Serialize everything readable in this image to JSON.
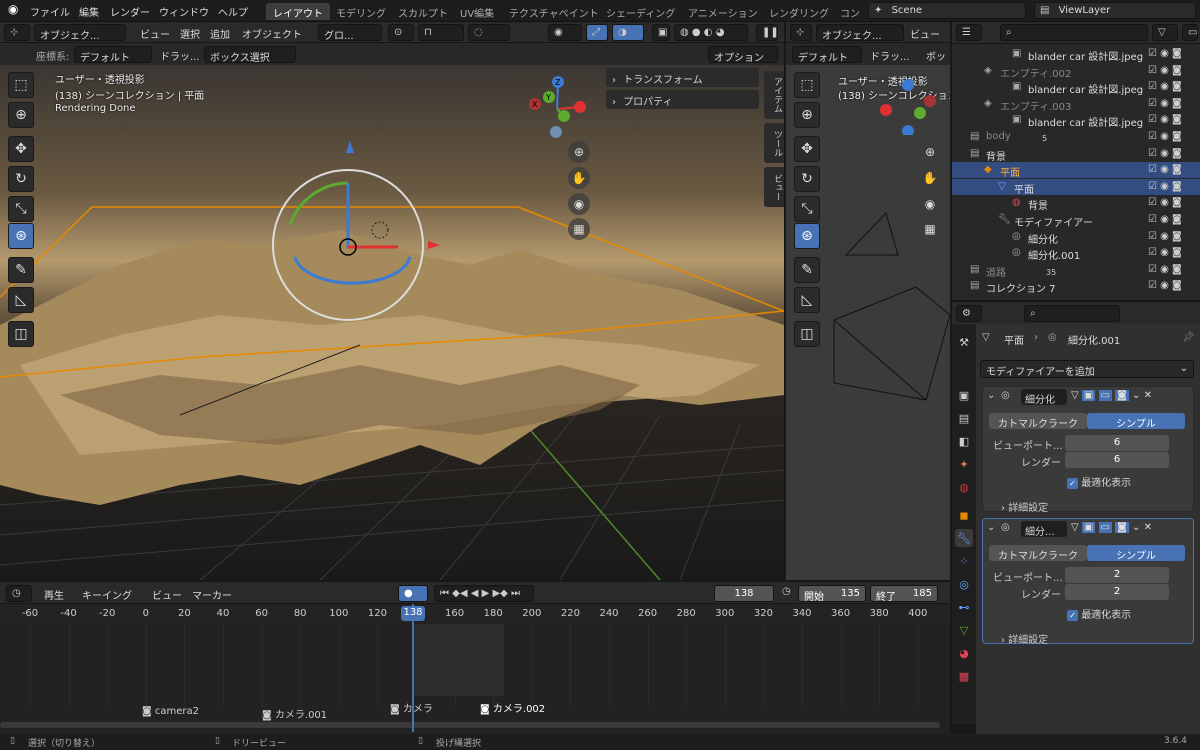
{
  "topbar": {
    "menus": [
      "ファイル",
      "編集",
      "レンダー",
      "ウィンドウ",
      "ヘルプ"
    ],
    "workspaces": [
      "レイアウト",
      "モデリング",
      "スカルプト",
      "UV編集",
      "テクスチャペイント",
      "シェーディング",
      "アニメーション",
      "レンダリング",
      "コン"
    ],
    "active_workspace": "レイアウト",
    "scene": "Scene",
    "view_layer": "ViewLayer"
  },
  "viewport_left": {
    "header": {
      "mode": "オブジェク...",
      "view": "ビュー",
      "select": "選択",
      "add": "追加",
      "object": "オブジェクト",
      "orientation": "グロ..."
    },
    "subheader": {
      "coord_label": "座標系:",
      "coord_value": "デフォルト",
      "drag_label": "ドラッ...",
      "select_mode": "ボックス選択",
      "options": "オプション"
    },
    "overlay": {
      "line1": "ユーザー・透視投影",
      "line2": "(138) シーンコレクション | 平面",
      "line3": "Rendering Done"
    },
    "panels": {
      "transform": "トランスフォーム",
      "properties": "プロパティ"
    },
    "side_tabs": [
      "アイテム",
      "ツール",
      "ビュー"
    ]
  },
  "viewport_right": {
    "header": {
      "mode": "オブジェク...",
      "view": "ビュー"
    },
    "subheader": {
      "coord_value": "デフォルト",
      "drag_label": "ドラッ...",
      "select_short": "ボッ"
    },
    "overlay": {
      "line1": "ユーザー・透視投影",
      "line2": "(138) シーンコレクション"
    }
  },
  "outliner": {
    "rows": [
      {
        "label": "blander car 設計図.jpeg",
        "indent": 4,
        "state": "normal"
      },
      {
        "label": "エンプティ.002",
        "indent": 2,
        "state": "dim"
      },
      {
        "label": "blander car 設計図.jpeg",
        "indent": 4,
        "state": "normal"
      },
      {
        "label": "エンプティ.003",
        "indent": 2,
        "state": "dim"
      },
      {
        "label": "blander car 設計図.jpeg",
        "indent": 4,
        "state": "normal"
      },
      {
        "label": "body",
        "indent": 1,
        "state": "dim"
      },
      {
        "label": "背景",
        "indent": 1,
        "state": "normal"
      },
      {
        "label": "平面",
        "indent": 2,
        "state": "selected"
      },
      {
        "label": "平面",
        "indent": 3,
        "state": "active"
      },
      {
        "label": "背景",
        "indent": 4,
        "state": "normal"
      },
      {
        "label": "モディファイアー",
        "indent": 3,
        "state": "normal"
      },
      {
        "label": "細分化",
        "indent": 4,
        "state": "normal"
      },
      {
        "label": "細分化.001",
        "indent": 4,
        "state": "normal"
      },
      {
        "label": "道路",
        "indent": 1,
        "state": "dim"
      },
      {
        "label": "コレクション 7",
        "indent": 1,
        "state": "normal"
      }
    ],
    "body_badge": "5",
    "road_badge": "35"
  },
  "properties": {
    "breadcrumb_object": "平面",
    "breadcrumb_modifier": "細分化.001",
    "add_modifier": "モディファイアーを追加",
    "modifiers": [
      {
        "name": "細分化",
        "tab_a": "カトマルクラーク",
        "tab_b": "シンプル",
        "viewport_label": "ビューポート...",
        "viewport_value": "6",
        "render_label": "レンダー",
        "render_value": "6",
        "optimal": "最適化表示",
        "advanced": "詳細設定"
      },
      {
        "name": "細分...",
        "tab_a": "カトマルクラーク",
        "tab_b": "シンプル",
        "viewport_label": "ビューポート...",
        "viewport_value": "2",
        "render_label": "レンダー",
        "render_value": "2",
        "optimal": "最適化表示",
        "advanced": "詳細設定"
      }
    ]
  },
  "timeline": {
    "playback": "再生",
    "keying": "キーイング",
    "view": "ビュー",
    "marker": "マーカー",
    "current_frame": "138",
    "start_label": "開始",
    "start_value": "135",
    "end_label": "終了",
    "end_value": "185",
    "ticks": [
      "-60",
      "-40",
      "-20",
      "0",
      "20",
      "40",
      "60",
      "80",
      "100",
      "120",
      "138",
      "160",
      "180",
      "200",
      "220",
      "240",
      "260",
      "280",
      "300",
      "320",
      "340",
      "360",
      "380",
      "400"
    ],
    "markers": [
      "camera2",
      "カメラ.001",
      "カメラ",
      "カメラ.002"
    ]
  },
  "statusbar": {
    "left": "選択（切り替え）",
    "middle": "ドリービュー",
    "right": "投げ縄選択",
    "version": "3.6.4"
  },
  "colors": {
    "accent": "#4772b3",
    "selection": "#334d80",
    "ortho_orange": "#e68a00"
  }
}
